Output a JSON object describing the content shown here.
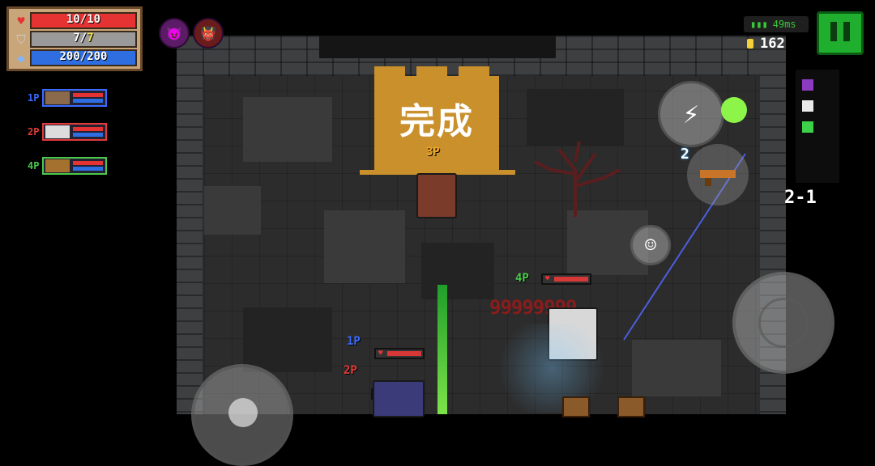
{
  "status": {
    "hp": {
      "current": "10",
      "max": "10",
      "text": "10/10",
      "fraction": 1.0
    },
    "armor": {
      "current": "7",
      "max": "7",
      "fraction": 1.0
    },
    "energy": {
      "text": "200/200",
      "fraction": 1.0
    }
  },
  "players": [
    {
      "label": "1P",
      "color": "#3a6bff"
    },
    {
      "label": "2P",
      "color": "#e43b3b"
    },
    {
      "label": "4P",
      "color": "#4cc94c"
    }
  ],
  "hud": {
    "ping": "49ms",
    "gold": "162",
    "level": "2-1",
    "skill_count": "2"
  },
  "banner": {
    "text": "完成",
    "owner": "3P"
  },
  "field": {
    "labels": {
      "p1": "1P",
      "p2": "2P",
      "p4": "4P"
    },
    "damage_text": "99999999"
  },
  "colors": {
    "accent_green": "#1fae2e",
    "hp_red": "#e53333",
    "armor_gray": "#9a9a9a",
    "energy_blue": "#2f6ee0",
    "banner_gold": "#c9902c"
  },
  "icons": [
    "heart-icon",
    "shield-icon",
    "diamond-icon",
    "signal-icon",
    "coin-icon",
    "lightning-icon",
    "smiley-icon",
    "crosshair-icon",
    "pause-icon"
  ]
}
